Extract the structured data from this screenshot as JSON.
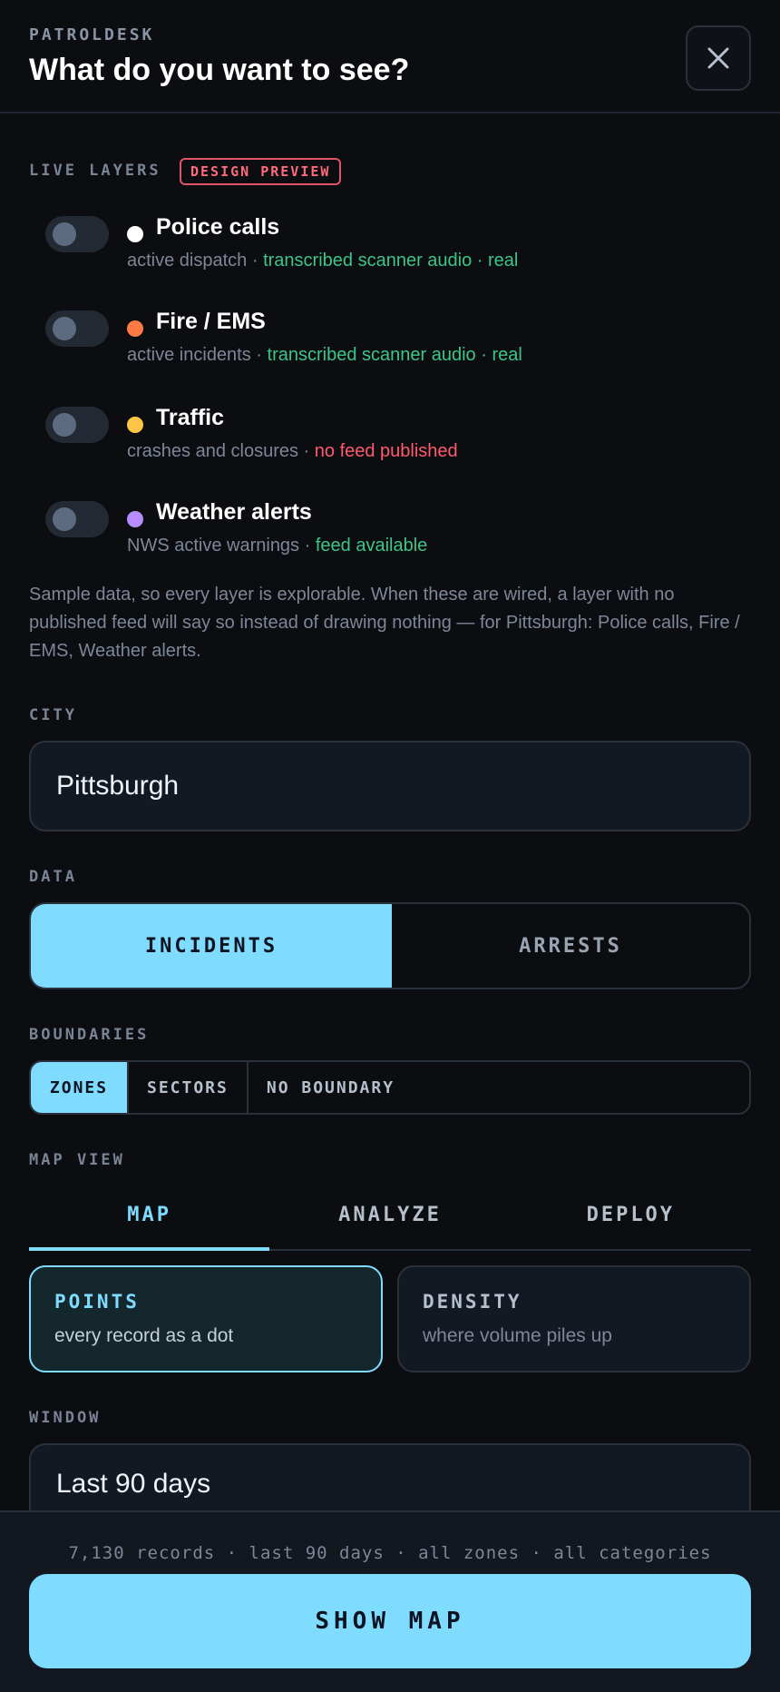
{
  "header": {
    "brand": "PATROLDESK",
    "title": "What do you want to see?"
  },
  "live_layers": {
    "label": "LIVE LAYERS",
    "badge": "DESIGN PREVIEW",
    "items": [
      {
        "name": "Police calls",
        "desc": "active dispatch",
        "source": "transcribed scanner audio",
        "status": "real",
        "dot_color": "#ffffff",
        "enabled": false
      },
      {
        "name": "Fire / EMS",
        "desc": "active incidents",
        "source": "transcribed scanner audio",
        "status": "real",
        "dot_color": "#ff7a45",
        "enabled": false
      },
      {
        "name": "Traffic",
        "desc": "crashes and closures",
        "status": "no feed published",
        "dot_color": "#ffc445",
        "enabled": false
      },
      {
        "name": "Weather alerts",
        "desc": "NWS active warnings",
        "status": "feed available",
        "dot_color": "#b88cff",
        "enabled": false
      }
    ],
    "note": "Sample data, so every layer is explorable. When these are wired, a layer with no published feed will say so instead of drawing nothing — for Pittsburgh: Police calls, Fire / EMS, Weather alerts."
  },
  "city": {
    "label": "CITY",
    "value": "Pittsburgh"
  },
  "data_type": {
    "label": "DATA",
    "options": [
      "INCIDENTS",
      "ARRESTS"
    ],
    "selected": "INCIDENTS"
  },
  "boundaries": {
    "label": "BOUNDARIES",
    "options": [
      "ZONES",
      "SECTORS",
      "NO BOUNDARY"
    ],
    "selected": "ZONES"
  },
  "map_view": {
    "label": "MAP VIEW",
    "tabs": [
      "MAP",
      "ANALYZE",
      "DEPLOY"
    ],
    "active_tab": "MAP",
    "modes": [
      {
        "title": "POINTS",
        "subtitle": "every record as a dot",
        "selected": true
      },
      {
        "title": "DENSITY",
        "subtitle": "where volume piles up",
        "selected": false
      }
    ]
  },
  "window": {
    "label": "WINDOW",
    "value": "Last 90 days"
  },
  "footer": {
    "summary": "7,130 records · last 90 days · all zones · all categories",
    "button": "SHOW MAP"
  },
  "colors": {
    "accent": "#7fdcff",
    "good": "#3ec58a",
    "bad": "#ff5a6e",
    "background": "#0b0d10"
  }
}
